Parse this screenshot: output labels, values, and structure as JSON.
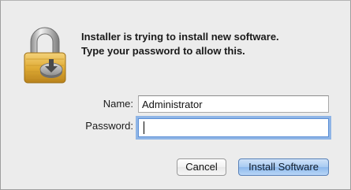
{
  "dialog": {
    "message_line1": "Installer is trying to install new software.",
    "message_line2": "Type your password to allow this."
  },
  "form": {
    "name_label": "Name:",
    "name_value": "Administrator",
    "password_label": "Password:",
    "password_value": ""
  },
  "buttons": {
    "cancel_label": "Cancel",
    "install_label": "Install Software"
  },
  "icons": {
    "lock": "padlock-icon",
    "badge": "installer-disk-icon"
  },
  "colors": {
    "dialog_background": "#ececec",
    "focus_ring": "#8fb5e6",
    "default_button": "#a8cbf2",
    "lock_gold": "#d9a92c"
  }
}
